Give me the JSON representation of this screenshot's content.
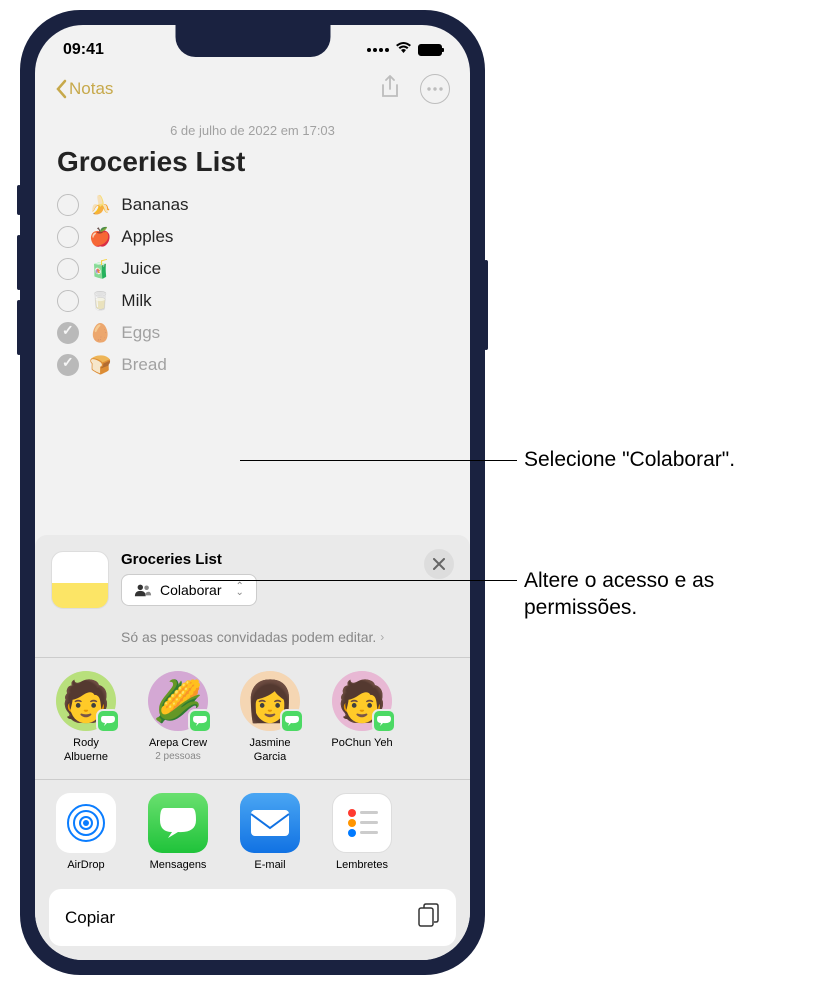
{
  "status": {
    "time": "09:41"
  },
  "notes": {
    "back": "Notas",
    "date": "6 de julho de 2022 em 17:03",
    "title": "Groceries List",
    "items": [
      {
        "emoji": "🍌",
        "text": "Bananas",
        "checked": false
      },
      {
        "emoji": "🍎",
        "text": "Apples",
        "checked": false
      },
      {
        "emoji": "🧃",
        "text": "Juice",
        "checked": false
      },
      {
        "emoji": "🥛",
        "text": "Milk",
        "checked": false
      },
      {
        "emoji": "🥚",
        "text": "Eggs",
        "checked": true
      },
      {
        "emoji": "🍞",
        "text": "Bread",
        "checked": true
      }
    ]
  },
  "share": {
    "title": "Groceries List",
    "collab_label": "Colaborar",
    "access_text": "Só as pessoas convidadas podem editar.",
    "people": [
      {
        "name": "Rody Albuerne",
        "sub": "",
        "color": "#b8e07c",
        "emoji": "🧑"
      },
      {
        "name": "Arepa Crew",
        "sub": "2 pessoas",
        "color": "#d4a8d4",
        "emoji": "🌽"
      },
      {
        "name": "Jasmine Garcia",
        "sub": "",
        "color": "#f5d6b3",
        "emoji": "👩"
      },
      {
        "name": "PoChun Yeh",
        "sub": "",
        "color": "#e8b8d4",
        "emoji": "🧑"
      }
    ],
    "apps": [
      {
        "name": "AirDrop",
        "class": "airdrop"
      },
      {
        "name": "Mensagens",
        "class": "messages"
      },
      {
        "name": "E-mail",
        "class": "mail"
      },
      {
        "name": "Lembretes",
        "class": "reminders"
      }
    ],
    "copy": "Copiar"
  },
  "callouts": {
    "c1": "Selecione \"Colaborar\".",
    "c2": "Altere o acesso e as permissões."
  }
}
